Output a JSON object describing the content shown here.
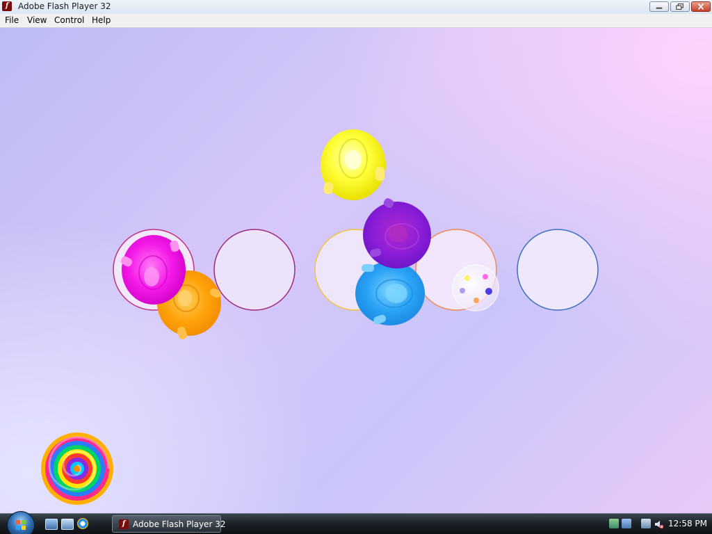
{
  "window": {
    "title": "Adobe Flash Player 32",
    "app_icon_glyph": "f",
    "controls": [
      "minimize",
      "maximize",
      "close"
    ]
  },
  "menu": {
    "items": [
      "File",
      "View",
      "Control",
      "Help"
    ]
  },
  "stage": {
    "slots": [
      {
        "name": "slot-magenta",
        "color": "#c0307a"
      },
      {
        "name": "slot-purple",
        "color": "#9b2a7a"
      },
      {
        "name": "slot-yellow",
        "color": "#f2c23a"
      },
      {
        "name": "slot-orange",
        "color": "#f08a55"
      },
      {
        "name": "slot-blue",
        "color": "#3a6ec0"
      }
    ],
    "balloons": [
      {
        "name": "balloon-yellow",
        "color": "#ffff3a"
      },
      {
        "name": "balloon-purple",
        "color": "#8a1dd8"
      },
      {
        "name": "balloon-magenta",
        "color": "#f41ae8"
      },
      {
        "name": "balloon-orange",
        "color": "#ffa30a"
      },
      {
        "name": "balloon-blue",
        "color": "#2aa2f5"
      }
    ],
    "extras": [
      "color-dots-bubble",
      "rainbow-spiral"
    ]
  },
  "taskbar": {
    "start_icon": "windows-orb-icon",
    "quick_launch": [
      "show-desktop-icon",
      "switch-windows-icon",
      "internet-explorer-icon"
    ],
    "task_button_label": "Adobe Flash Player 32",
    "tray_icons": [
      "network-icon",
      "network-icon-2",
      "display-icon",
      "volume-muted-icon"
    ],
    "clock": "12:58 PM"
  },
  "colors": {
    "stage_top_right": "#ffd3fb",
    "stage_main": "#c9c5fa",
    "taskbar": "#1c2228"
  }
}
